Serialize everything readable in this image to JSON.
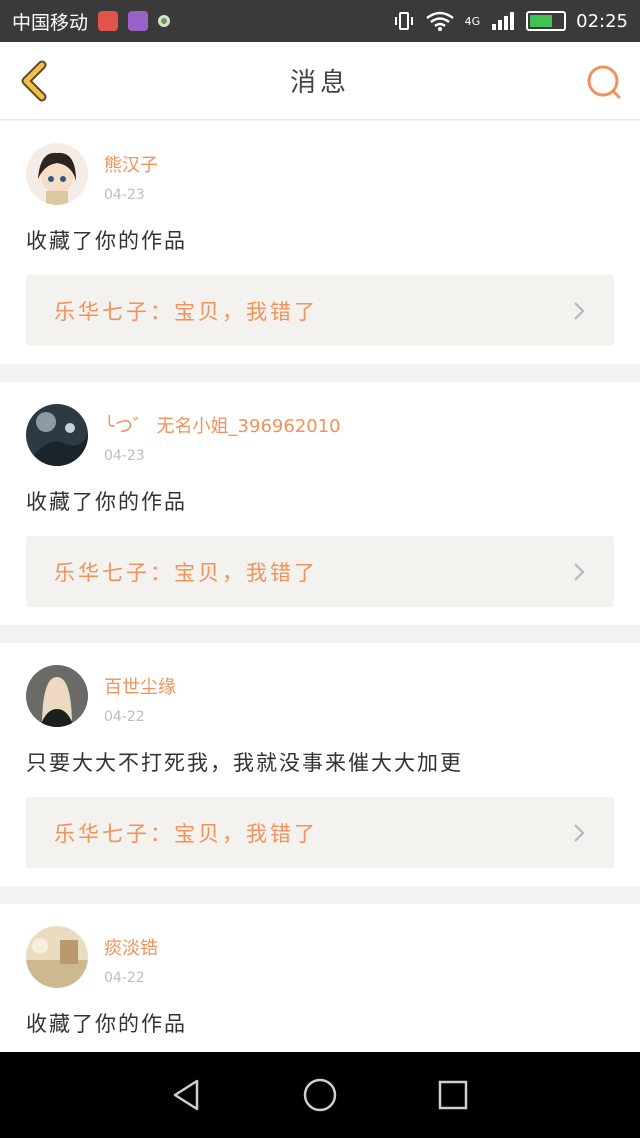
{
  "status_bar": {
    "carrier": "中国移动",
    "network": "4G",
    "time": "02:25",
    "battery_level": 0.6
  },
  "header": {
    "title": "消息",
    "back_icon": "chevron-left-icon",
    "search_icon": "search-icon"
  },
  "colors": {
    "accent": "#f2915a",
    "icon_yellow": "#f2c04a",
    "work_bg": "#f3f2ee"
  },
  "messages": [
    {
      "username": "熊汉子",
      "date": "04-23",
      "action": "收藏了你的作品",
      "work": "乐华七子：宝贝，我错了"
    },
    {
      "username": "╰つ゛ 无名小姐_396962010",
      "date": "04-23",
      "action": "收藏了你的作品",
      "work": "乐华七子：宝贝，我错了"
    },
    {
      "username": "百世尘缘",
      "date": "04-22",
      "action": "只要大大不打死我，我就没事来催大大加更",
      "work": "乐华七子：宝贝，我错了"
    },
    {
      "username": "痰淡锆",
      "date": "04-22",
      "action": "收藏了你的作品",
      "work": ""
    }
  ],
  "nav_bar": {
    "back_icon": "triangle-back-icon",
    "home_icon": "circle-home-icon",
    "recents_icon": "square-recents-icon"
  }
}
